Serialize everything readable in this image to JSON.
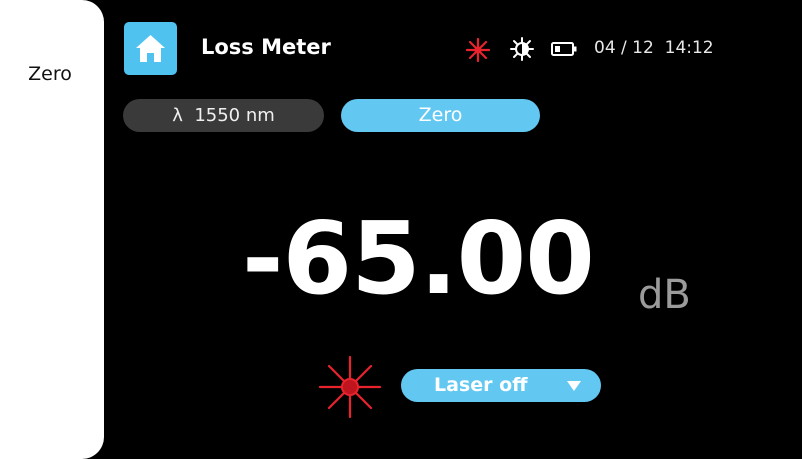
{
  "app": {
    "title": "Loss Meter"
  },
  "side": {
    "zero_label": "Zero"
  },
  "status": {
    "date": "04 / 12",
    "time": "14:12"
  },
  "wavelength": {
    "symbol": "λ",
    "value": "1550 nm"
  },
  "zero_button": {
    "label": "Zero"
  },
  "reading": {
    "value": "-65.00",
    "unit": "dB"
  },
  "laser": {
    "selected": "Laser off"
  },
  "icons": [
    "home-icon",
    "laser-status-icon",
    "brightness-icon",
    "battery-icon",
    "laser-icon",
    "chevron-down-icon"
  ],
  "colors": {
    "accent": "#62c8f2",
    "laser": "#e8232d",
    "background": "#000000"
  }
}
